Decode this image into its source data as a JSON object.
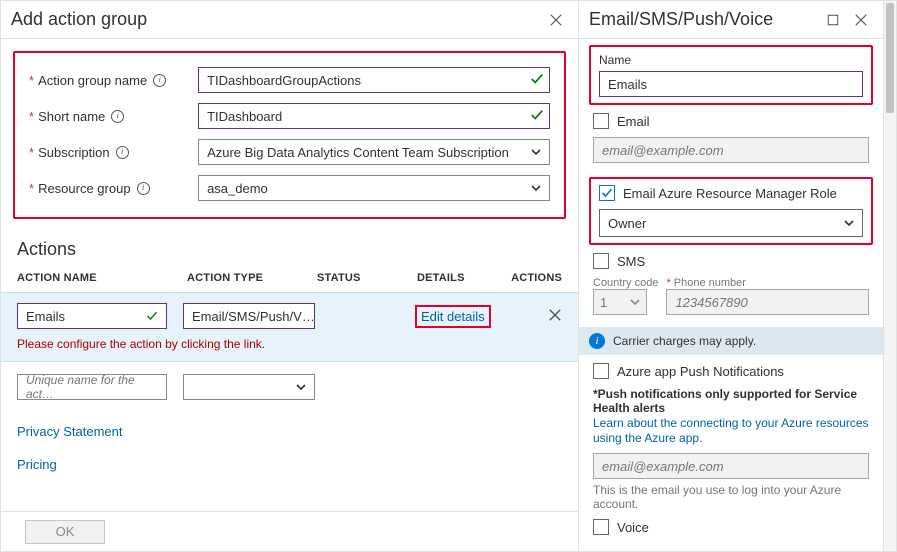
{
  "left": {
    "title": "Add action group",
    "fields": {
      "action_group_name": {
        "label": "Action group name",
        "value": "TIDashboardGroupActions"
      },
      "short_name": {
        "label": "Short name",
        "value": "TIDashboard"
      },
      "subscription": {
        "label": "Subscription",
        "value": "Azure Big Data Analytics Content Team Subscription"
      },
      "resource_group": {
        "label": "Resource group",
        "value": "asa_demo"
      }
    },
    "actions_header": "Actions",
    "columns": {
      "name": "ACTION NAME",
      "type": "ACTION TYPE",
      "status": "STATUS",
      "details": "DETAILS",
      "actions": "ACTIONS"
    },
    "row1": {
      "name": "Emails",
      "type": "Email/SMS/Push/V…",
      "details_link": "Edit details"
    },
    "warning": "Please configure the action by clicking the link.",
    "row2_placeholder": "Unique name for the act…",
    "links": {
      "privacy": "Privacy Statement",
      "pricing": "Pricing"
    },
    "ok": "OK"
  },
  "right": {
    "title": "Email/SMS/Push/Voice",
    "name_label": "Name",
    "name_value": "Emails",
    "email_label": "Email",
    "email_placeholder": "email@example.com",
    "arm_label": "Email Azure Resource Manager Role",
    "arm_value": "Owner",
    "sms_label": "SMS",
    "country_label": "Country code",
    "country_value": "1",
    "phone_label": "Phone number",
    "phone_placeholder": "1234567890",
    "charges": "Carrier charges may apply.",
    "push_label": "Azure app Push Notifications",
    "push_note": "*Push notifications only supported for Service Health alerts",
    "push_link": "Learn about the connecting to your Azure resources using the Azure app.",
    "push_placeholder": "email@example.com",
    "push_hint": "This is the email you use to log into your Azure account.",
    "voice_label": "Voice"
  }
}
